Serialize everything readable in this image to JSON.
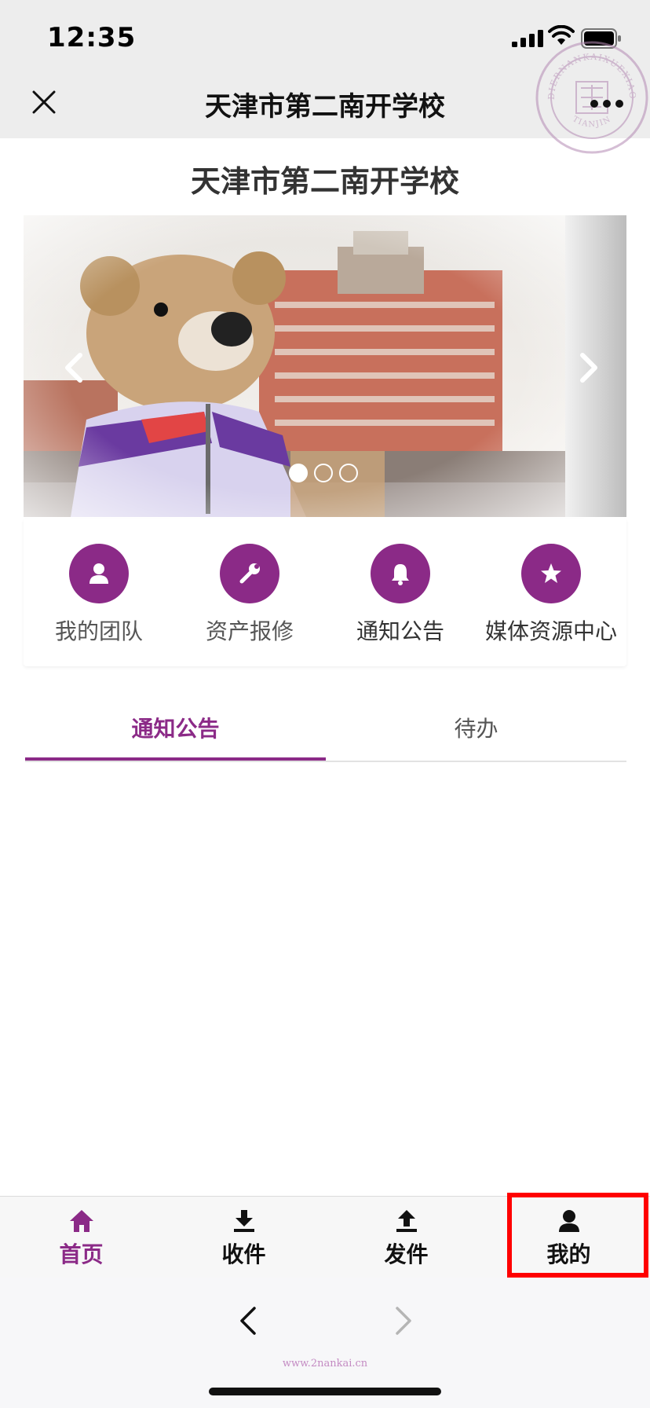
{
  "status_bar": {
    "time": "12:35"
  },
  "nav": {
    "title": "天津市第二南开学校",
    "close_icon": "close-icon",
    "more_icon": "more-icon"
  },
  "seal": {
    "ring_top": "DIERNANKAIXUEXIAO",
    "ring_bottom": "TIANJIN"
  },
  "page": {
    "title": "天津市第二南开学校"
  },
  "carousel": {
    "slide_count": 3,
    "active_index": 0
  },
  "quick_actions": [
    {
      "label": "我的团队",
      "icon": "user-icon"
    },
    {
      "label": "资产报修",
      "icon": "wrench-icon"
    },
    {
      "label": "通知公告",
      "icon": "bell-icon"
    },
    {
      "label": "媒体资源中心",
      "icon": "star-icon"
    }
  ],
  "tabs": [
    {
      "label": "通知公告",
      "active": true
    },
    {
      "label": "待办",
      "active": false
    }
  ],
  "tabbar": [
    {
      "label": "首页",
      "icon": "home-icon",
      "active": true
    },
    {
      "label": "收件",
      "icon": "download-icon",
      "active": false
    },
    {
      "label": "发件",
      "icon": "upload-icon",
      "active": false
    },
    {
      "label": "我的",
      "icon": "person-icon",
      "active": false
    }
  ],
  "footer": {
    "watermark": "www.2nankai.cn"
  },
  "colors": {
    "accent": "#8b2a87",
    "highlight": "#ff0000",
    "nav_bg": "#ededed"
  }
}
